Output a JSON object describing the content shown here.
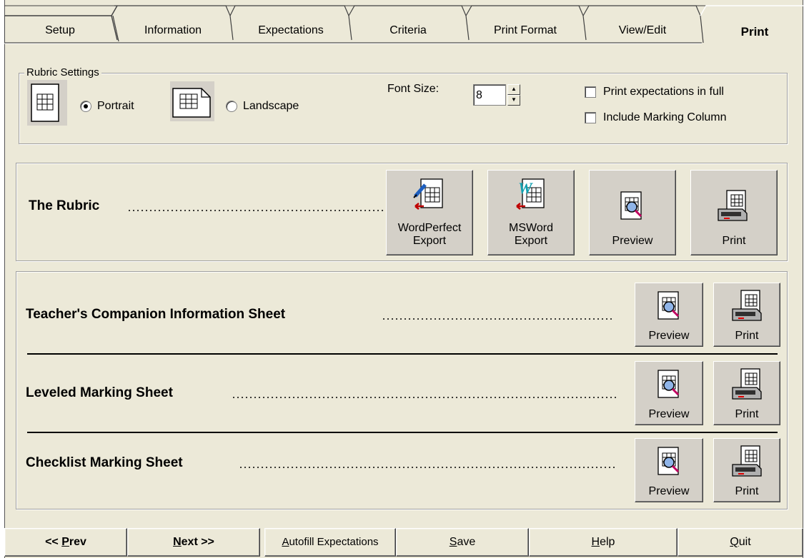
{
  "tabs": [
    {
      "label": "Setup"
    },
    {
      "label": "Information"
    },
    {
      "label": "Expectations"
    },
    {
      "label": "Criteria"
    },
    {
      "label": "Print Format"
    },
    {
      "label": "View/Edit"
    },
    {
      "label": "Print"
    }
  ],
  "rubric_settings": {
    "legend": "Rubric Settings",
    "orientation": {
      "portrait": "Portrait",
      "landscape": "Landscape",
      "selected": "Portrait"
    },
    "font_size": {
      "label": "Font Size:",
      "value": "8"
    },
    "print_expectations_full": {
      "label": "Print expectations in full",
      "checked": false
    },
    "include_marking_column": {
      "label": "Include Marking Column",
      "checked": false
    }
  },
  "rubric": {
    "title": "The Rubric",
    "buttons": {
      "wordperfect": {
        "line1": "WordPerfect",
        "line2": "Export"
      },
      "msword": {
        "line1": "MSWord",
        "line2": "Export"
      },
      "preview": "Preview",
      "print": "Print"
    }
  },
  "sheets": [
    {
      "title": "Teacher's Companion Information Sheet",
      "preview": "Preview",
      "print": "Print"
    },
    {
      "title": "Leveled Marking Sheet",
      "preview": "Preview",
      "print": "Print"
    },
    {
      "title": "Checklist Marking Sheet",
      "preview": "Preview",
      "print": "Print"
    }
  ],
  "footer": {
    "prev": {
      "prefix": "<< ",
      "accel": "P",
      "rest": "rev"
    },
    "next": {
      "accel": "N",
      "rest": "ext >>"
    },
    "autofill": {
      "accel": "A",
      "rest": "utofill Expectations"
    },
    "save": {
      "accel": "S",
      "rest": "ave"
    },
    "help": {
      "accel": "H",
      "rest": "elp"
    },
    "quit": {
      "accel": "Q",
      "rest": "uit"
    }
  }
}
